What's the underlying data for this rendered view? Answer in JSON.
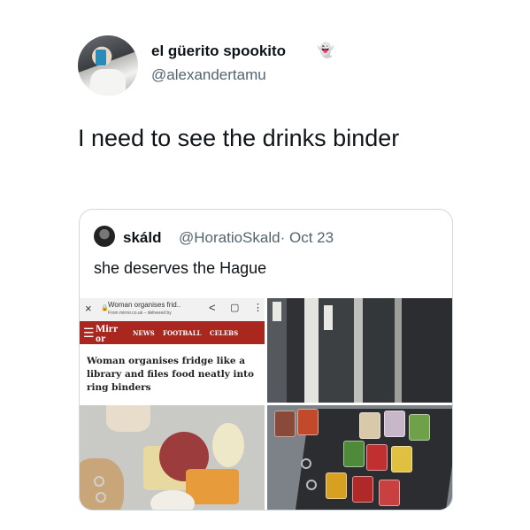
{
  "tweet": {
    "author_name": "el güerito spookito",
    "author_emoji": "👻",
    "author_handle": "@alexandertamu",
    "text": "I need to see the drinks binder"
  },
  "quote": {
    "author_name": "skáld",
    "author_handle_date": "@HoratioSkald· Oct 23",
    "text": "she deserves the Hague"
  },
  "screenshot": {
    "close_glyph": "×",
    "lock_glyph": "🔒",
    "page_title": "Woman organises frid..",
    "url": "From mirror.co.uk – delivered by",
    "share_glyph": "<",
    "bookmark_glyph": "▢",
    "menu_glyph": "⋮",
    "menu_icon_glyph": "☰",
    "logo_line1": "Mirr",
    "logo_line2": "or",
    "nav_items": [
      "NEWS",
      "FOOTBALL",
      "CELEBS"
    ],
    "headline": "Woman organises fridge like a library and files food neatly into ring binders"
  },
  "colors": {
    "mirror_red": "#a9271f",
    "text_primary": "#0f1419",
    "text_secondary": "#536471",
    "border": "#cfd9de"
  },
  "icons": [
    "ghost-icon",
    "close-icon",
    "lock-icon",
    "share-icon",
    "bookmark-icon",
    "menu-icon"
  ]
}
